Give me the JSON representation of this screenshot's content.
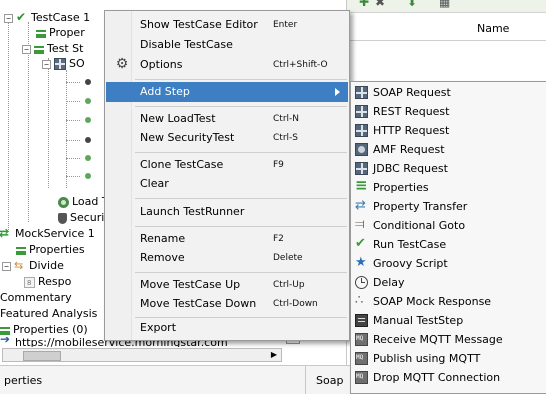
{
  "tree": {
    "nodes": [
      {
        "label": "TestCase 1",
        "icon": "check-icon"
      },
      {
        "label": "Proper",
        "icon": "properties-icon"
      },
      {
        "label": "Test St",
        "icon": "properties-icon"
      },
      {
        "label": "SO",
        "icon": "soap-request-icon"
      },
      {
        "label": "Load T",
        "icon": "load-test-icon"
      },
      {
        "label": "Securit",
        "icon": "security-test-icon"
      },
      {
        "label": "MockService 1",
        "icon": "mock-service-icon"
      },
      {
        "label": "Properties",
        "icon": "properties-icon"
      },
      {
        "label": "Divide",
        "icon": "mock-operation-icon"
      },
      {
        "label": "Respo",
        "icon": "mock-response-icon"
      },
      {
        "label": "Commentary",
        "icon": ""
      },
      {
        "label": "Featured Analysis",
        "icon": ""
      },
      {
        "label": "Properties (0)",
        "icon": "properties-icon"
      },
      {
        "label": "https://mobileservice.morningstar.com",
        "icon": "arrow-icon"
      }
    ]
  },
  "bottom": {
    "left_label": "perties",
    "mid_label": "Soap"
  },
  "editor": {
    "name_header": "Name"
  },
  "context_menu": {
    "items": [
      {
        "label": "Show TestCase Editor",
        "accel": "Enter"
      },
      {
        "label": "Disable TestCase",
        "accel": ""
      },
      {
        "label": "Options",
        "accel": "Ctrl+Shift-O"
      },
      {
        "label": "Add Step",
        "accel": ""
      },
      {
        "label": "New LoadTest",
        "accel": "Ctrl-N"
      },
      {
        "label": "New SecurityTest",
        "accel": "Ctrl-S"
      },
      {
        "label": "Clone TestCase",
        "accel": "F9"
      },
      {
        "label": "Clear",
        "accel": ""
      },
      {
        "label": "Launch TestRunner",
        "accel": ""
      },
      {
        "label": "Rename",
        "accel": "F2"
      },
      {
        "label": "Remove",
        "accel": "Delete"
      },
      {
        "label": "Move TestCase Up",
        "accel": "Ctrl-Up"
      },
      {
        "label": "Move TestCase Down",
        "accel": "Ctrl-Down"
      },
      {
        "label": "Export",
        "accel": ""
      }
    ],
    "highlighted": "Add Step",
    "highlight_color": "#3d7fc2"
  },
  "add_step_menu": {
    "items": [
      {
        "label": "SOAP Request",
        "icon": "soap-request-icon"
      },
      {
        "label": "REST Request",
        "icon": "rest-request-icon"
      },
      {
        "label": "HTTP Request",
        "icon": "http-request-icon"
      },
      {
        "label": "AMF Request",
        "icon": "amf-request-icon"
      },
      {
        "label": "JDBC Request",
        "icon": "jdbc-request-icon"
      },
      {
        "label": "Properties",
        "icon": "properties-icon"
      },
      {
        "label": "Property Transfer",
        "icon": "property-transfer-icon"
      },
      {
        "label": "Conditional Goto",
        "icon": "conditional-goto-icon"
      },
      {
        "label": "Run TestCase",
        "icon": "run-testcase-icon"
      },
      {
        "label": "Groovy Script",
        "icon": "groovy-script-icon"
      },
      {
        "label": "Delay",
        "icon": "delay-icon"
      },
      {
        "label": "SOAP Mock Response",
        "icon": "soap-mock-response-icon"
      },
      {
        "label": "Manual TestStep",
        "icon": "manual-teststep-icon"
      },
      {
        "label": "Receive MQTT Message",
        "icon": "mqtt-receive-icon"
      },
      {
        "label": "Publish using MQTT",
        "icon": "mqtt-publish-icon"
      },
      {
        "label": "Drop MQTT Connection",
        "icon": "mqtt-drop-icon"
      }
    ]
  }
}
